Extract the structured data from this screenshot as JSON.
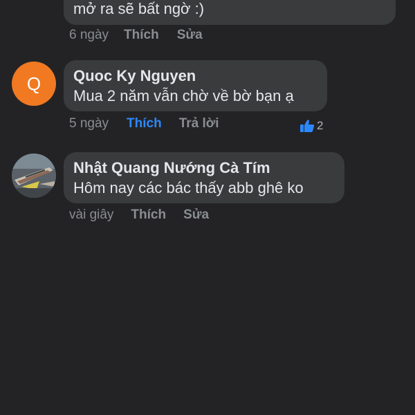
{
  "comments": [
    {
      "text": "mở ra sẽ bất ngờ :)",
      "time": "6 ngày",
      "like_label": "Thích",
      "edit_label": "Sửa"
    },
    {
      "author": "Quoc Ky Nguyen",
      "avatar_letter": "Q",
      "text": "Mua 2 năm vẫn chờ về bờ bạn ạ",
      "time": "5 ngày",
      "like_label": "Thích",
      "reply_label": "Trả lời",
      "reaction_icon": "thumbs-up-icon",
      "reaction_count": "2",
      "liked": true
    },
    {
      "author": "Nhật Quang Nướng Cà Tím",
      "avatar_icon": "fish-photo-avatar",
      "text": "Hôm nay các bác thấy abb ghê ko",
      "time": "vài giây",
      "like_label": "Thích",
      "edit_label": "Sửa"
    }
  ],
  "colors": {
    "background": "#232325",
    "bubble": "#3a3b3c",
    "text": "#e4e6eb",
    "meta": "#8a8d91",
    "accent": "#2d88ff",
    "avatar_q": "#f07922"
  }
}
